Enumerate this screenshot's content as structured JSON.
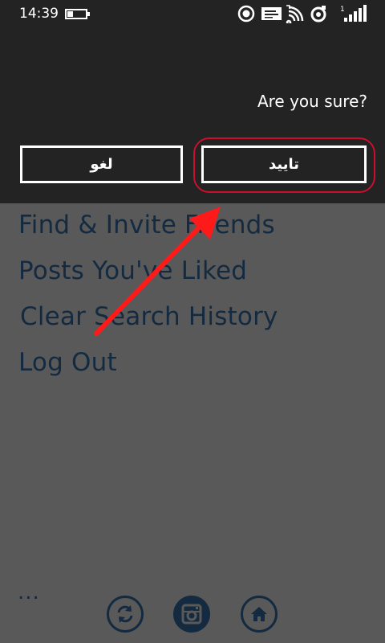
{
  "status_bar": {
    "time": "14:39",
    "icons": [
      "battery-icon",
      "location-icon",
      "message-icon",
      "wifi-icon",
      "sync-icon",
      "signal-icon"
    ]
  },
  "dialog": {
    "message": "Are you sure?",
    "cancel_label": "لغو",
    "confirm_label": "تایید"
  },
  "menu": {
    "items": [
      {
        "label": "Find & Invite Friends"
      },
      {
        "label": "Posts You've Liked"
      },
      {
        "label": "Clear Search History"
      },
      {
        "label": "Log Out"
      }
    ]
  },
  "app_bar": {
    "more_label": "...",
    "buttons": [
      "refresh-icon",
      "instagram-icon",
      "home-icon"
    ]
  },
  "colors": {
    "dialog_bg": "#232323",
    "overlay_bg": "#595959",
    "menu_text": "#142a40",
    "highlight": "#c8102e",
    "arrow": "#ff1a1a"
  }
}
